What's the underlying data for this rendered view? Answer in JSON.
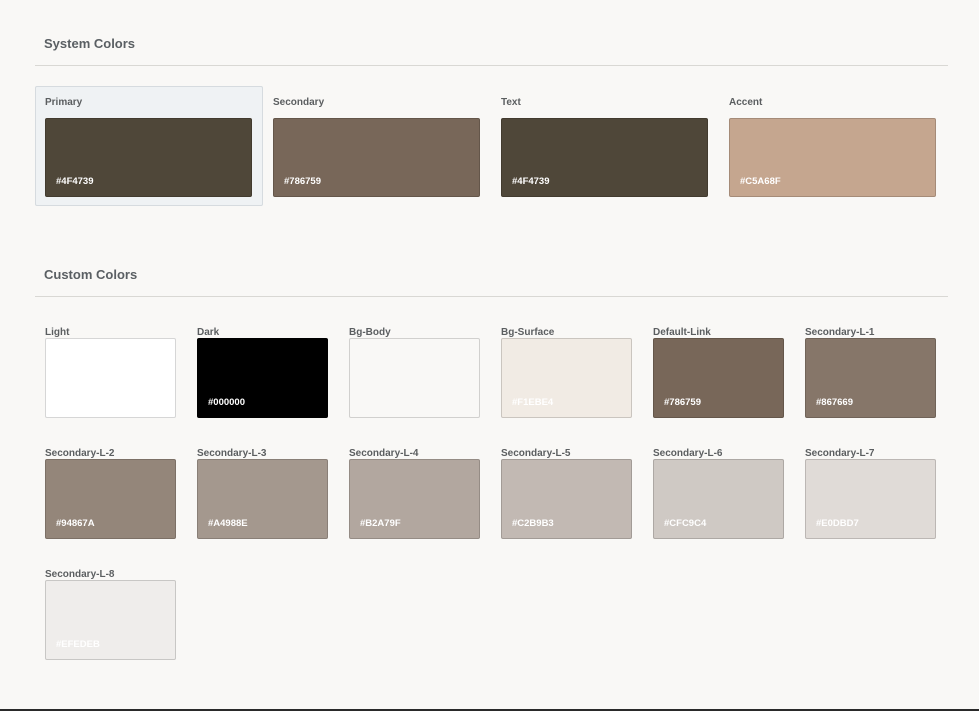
{
  "system": {
    "title": "System Colors",
    "colors": [
      {
        "label": "Primary",
        "hex": "#4F4739",
        "color": "#4f4739"
      },
      {
        "label": "Secondary",
        "hex": "#786759",
        "color": "#786759"
      },
      {
        "label": "Text",
        "hex": "#4F4739",
        "color": "#4f4739"
      },
      {
        "label": "Accent",
        "hex": "#C5A68F",
        "color": "#c5a68f"
      }
    ]
  },
  "custom": {
    "title": "Custom Colors",
    "colors": [
      {
        "label": "Light",
        "hex": "",
        "color": "#ffffff"
      },
      {
        "label": "Dark",
        "hex": "#000000",
        "color": "#000000"
      },
      {
        "label": "Bg-Body",
        "hex": "",
        "color": "#f9f8f6"
      },
      {
        "label": "Bg-Surface",
        "hex": "#F1EBE4",
        "color": "#f1ebe4"
      },
      {
        "label": "Default-Link",
        "hex": "#786759",
        "color": "#786759"
      },
      {
        "label": "Secondary-L-1",
        "hex": "#867669",
        "color": "#867669"
      },
      {
        "label": "Secondary-L-2",
        "hex": "#94867A",
        "color": "#94867a"
      },
      {
        "label": "Secondary-L-3",
        "hex": "#A4988E",
        "color": "#a4988e"
      },
      {
        "label": "Secondary-L-4",
        "hex": "#B2A79F",
        "color": "#b2a79f"
      },
      {
        "label": "Secondary-L-5",
        "hex": "#C2B9B3",
        "color": "#c2b9b3"
      },
      {
        "label": "Secondary-L-6",
        "hex": "#CFC9C4",
        "color": "#cfc9c4"
      },
      {
        "label": "Secondary-L-7",
        "hex": "#E0DBD7",
        "color": "#e0dbd7"
      },
      {
        "label": "Secondary-L-8",
        "hex": "#EFEDEB",
        "color": "#efedeb"
      }
    ]
  }
}
